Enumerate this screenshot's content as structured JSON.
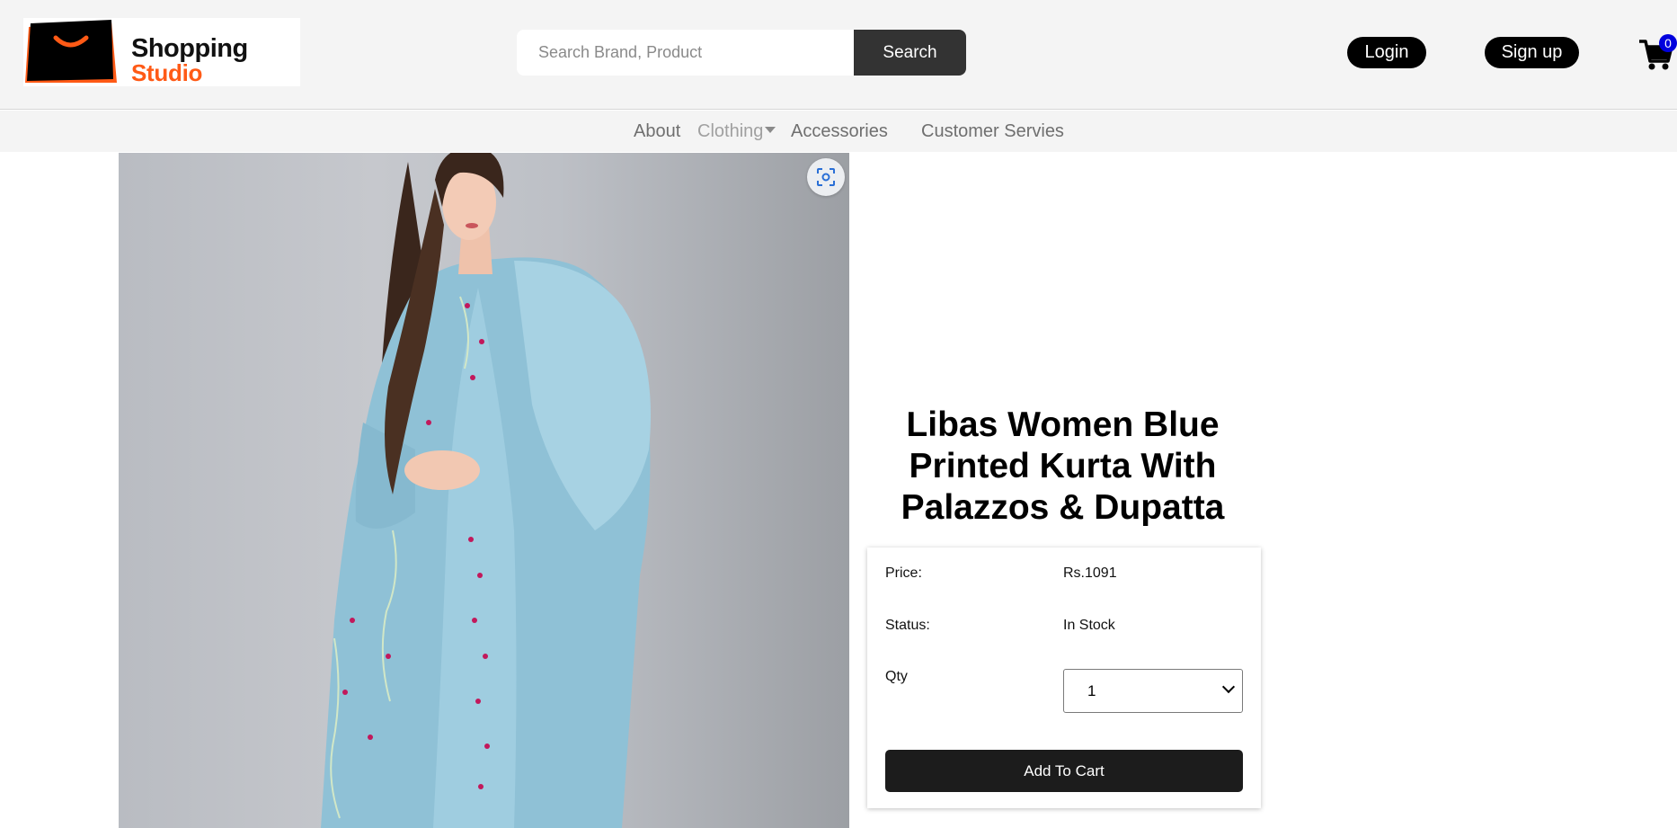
{
  "header": {
    "logo": {
      "line1": "Shopping",
      "line2": "Studio"
    },
    "search": {
      "placeholder": "Search Brand, Product",
      "value": "",
      "button_label": "Search"
    },
    "login_label": "Login",
    "signup_label": "Sign up",
    "cart": {
      "count": "0"
    }
  },
  "nav": {
    "items": [
      {
        "label": "About"
      },
      {
        "label": "Clothing"
      },
      {
        "label": "Accessories"
      },
      {
        "label": "Customer Servies"
      }
    ]
  },
  "product": {
    "title": "Libas Women Blue Printed Kurta With Palazzos & Dupatta",
    "price_label": "Price:",
    "price_value": "Rs.1091",
    "status_label": "Status:",
    "status_value": "In Stock",
    "qty_label": "Qty",
    "qty_value": "1",
    "add_to_cart_label": "Add To Cart"
  },
  "colors": {
    "header_bg": "#f4f4f4",
    "accent_orange": "#ff5a16",
    "button_dark": "#1c1c1c",
    "cart_badge": "#0000dd"
  }
}
